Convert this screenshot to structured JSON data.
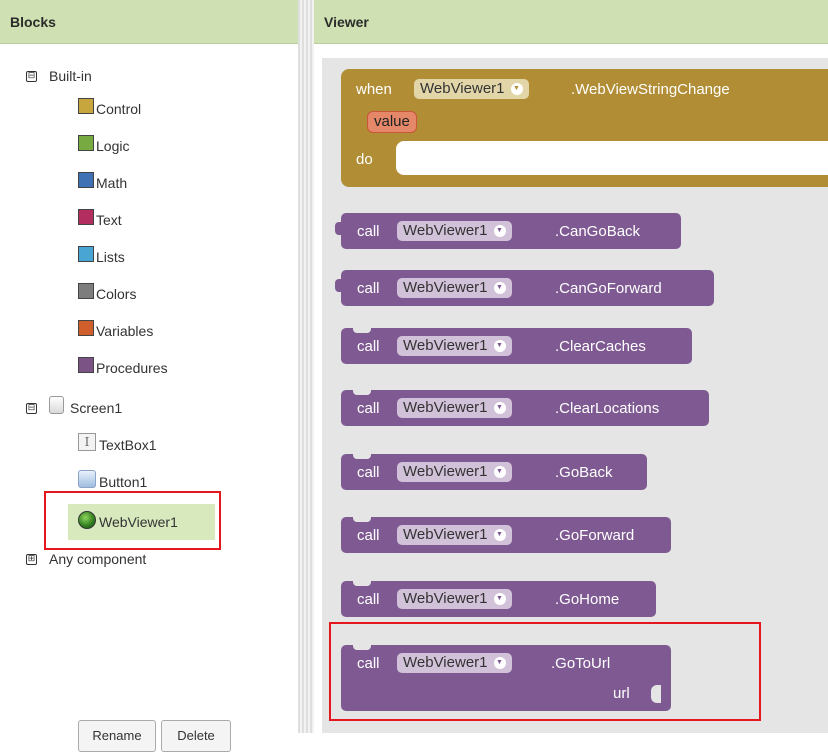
{
  "panels": {
    "blocks_title": "Blocks",
    "viewer_title": "Viewer"
  },
  "tree": {
    "builtin": {
      "toggle": "⊟",
      "label": "Built-in",
      "items": [
        {
          "label": "Control",
          "color": "#c8a63e"
        },
        {
          "label": "Logic",
          "color": "#77ab41"
        },
        {
          "label": "Math",
          "color": "#3f71b5"
        },
        {
          "label": "Text",
          "color": "#b32d5e"
        },
        {
          "label": "Lists",
          "color": "#49a6d4"
        },
        {
          "label": "Colors",
          "color": "#7d7d7d"
        },
        {
          "label": "Variables",
          "color": "#d05f2d"
        },
        {
          "label": "Procedures",
          "color": "#7c5385"
        }
      ]
    },
    "screen": {
      "toggle": "⊟",
      "label": "Screen1",
      "components": [
        {
          "label": "TextBox1",
          "icon": "textbox-icon"
        },
        {
          "label": "Button1",
          "icon": "button-icon"
        },
        {
          "label": "WebViewer1",
          "icon": "globe-icon"
        }
      ]
    },
    "any": {
      "toggle": "⊞",
      "label": "Any component"
    }
  },
  "buttons": {
    "rename": "Rename",
    "delete": "Delete"
  },
  "colors": {
    "event_block": "#b18e35",
    "method_block": "#7f5a92",
    "highlight_box": "#e3171d"
  },
  "event_block": {
    "when": "when",
    "component": "WebViewer1",
    "event": ".WebViewStringChange",
    "param": "value",
    "do": "do"
  },
  "method_blocks": [
    {
      "call": "call",
      "component": "WebViewer1",
      "method": ".CanGoBack"
    },
    {
      "call": "call",
      "component": "WebViewer1",
      "method": ".CanGoForward"
    },
    {
      "call": "call",
      "component": "WebViewer1",
      "method": ".ClearCaches"
    },
    {
      "call": "call",
      "component": "WebViewer1",
      "method": ".ClearLocations"
    },
    {
      "call": "call",
      "component": "WebViewer1",
      "method": ".GoBack"
    },
    {
      "call": "call",
      "component": "WebViewer1",
      "method": ".GoForward"
    },
    {
      "call": "call",
      "component": "WebViewer1",
      "method": ".GoHome"
    },
    {
      "call": "call",
      "component": "WebViewer1",
      "method": ".GoToUrl",
      "arg": "url"
    }
  ]
}
